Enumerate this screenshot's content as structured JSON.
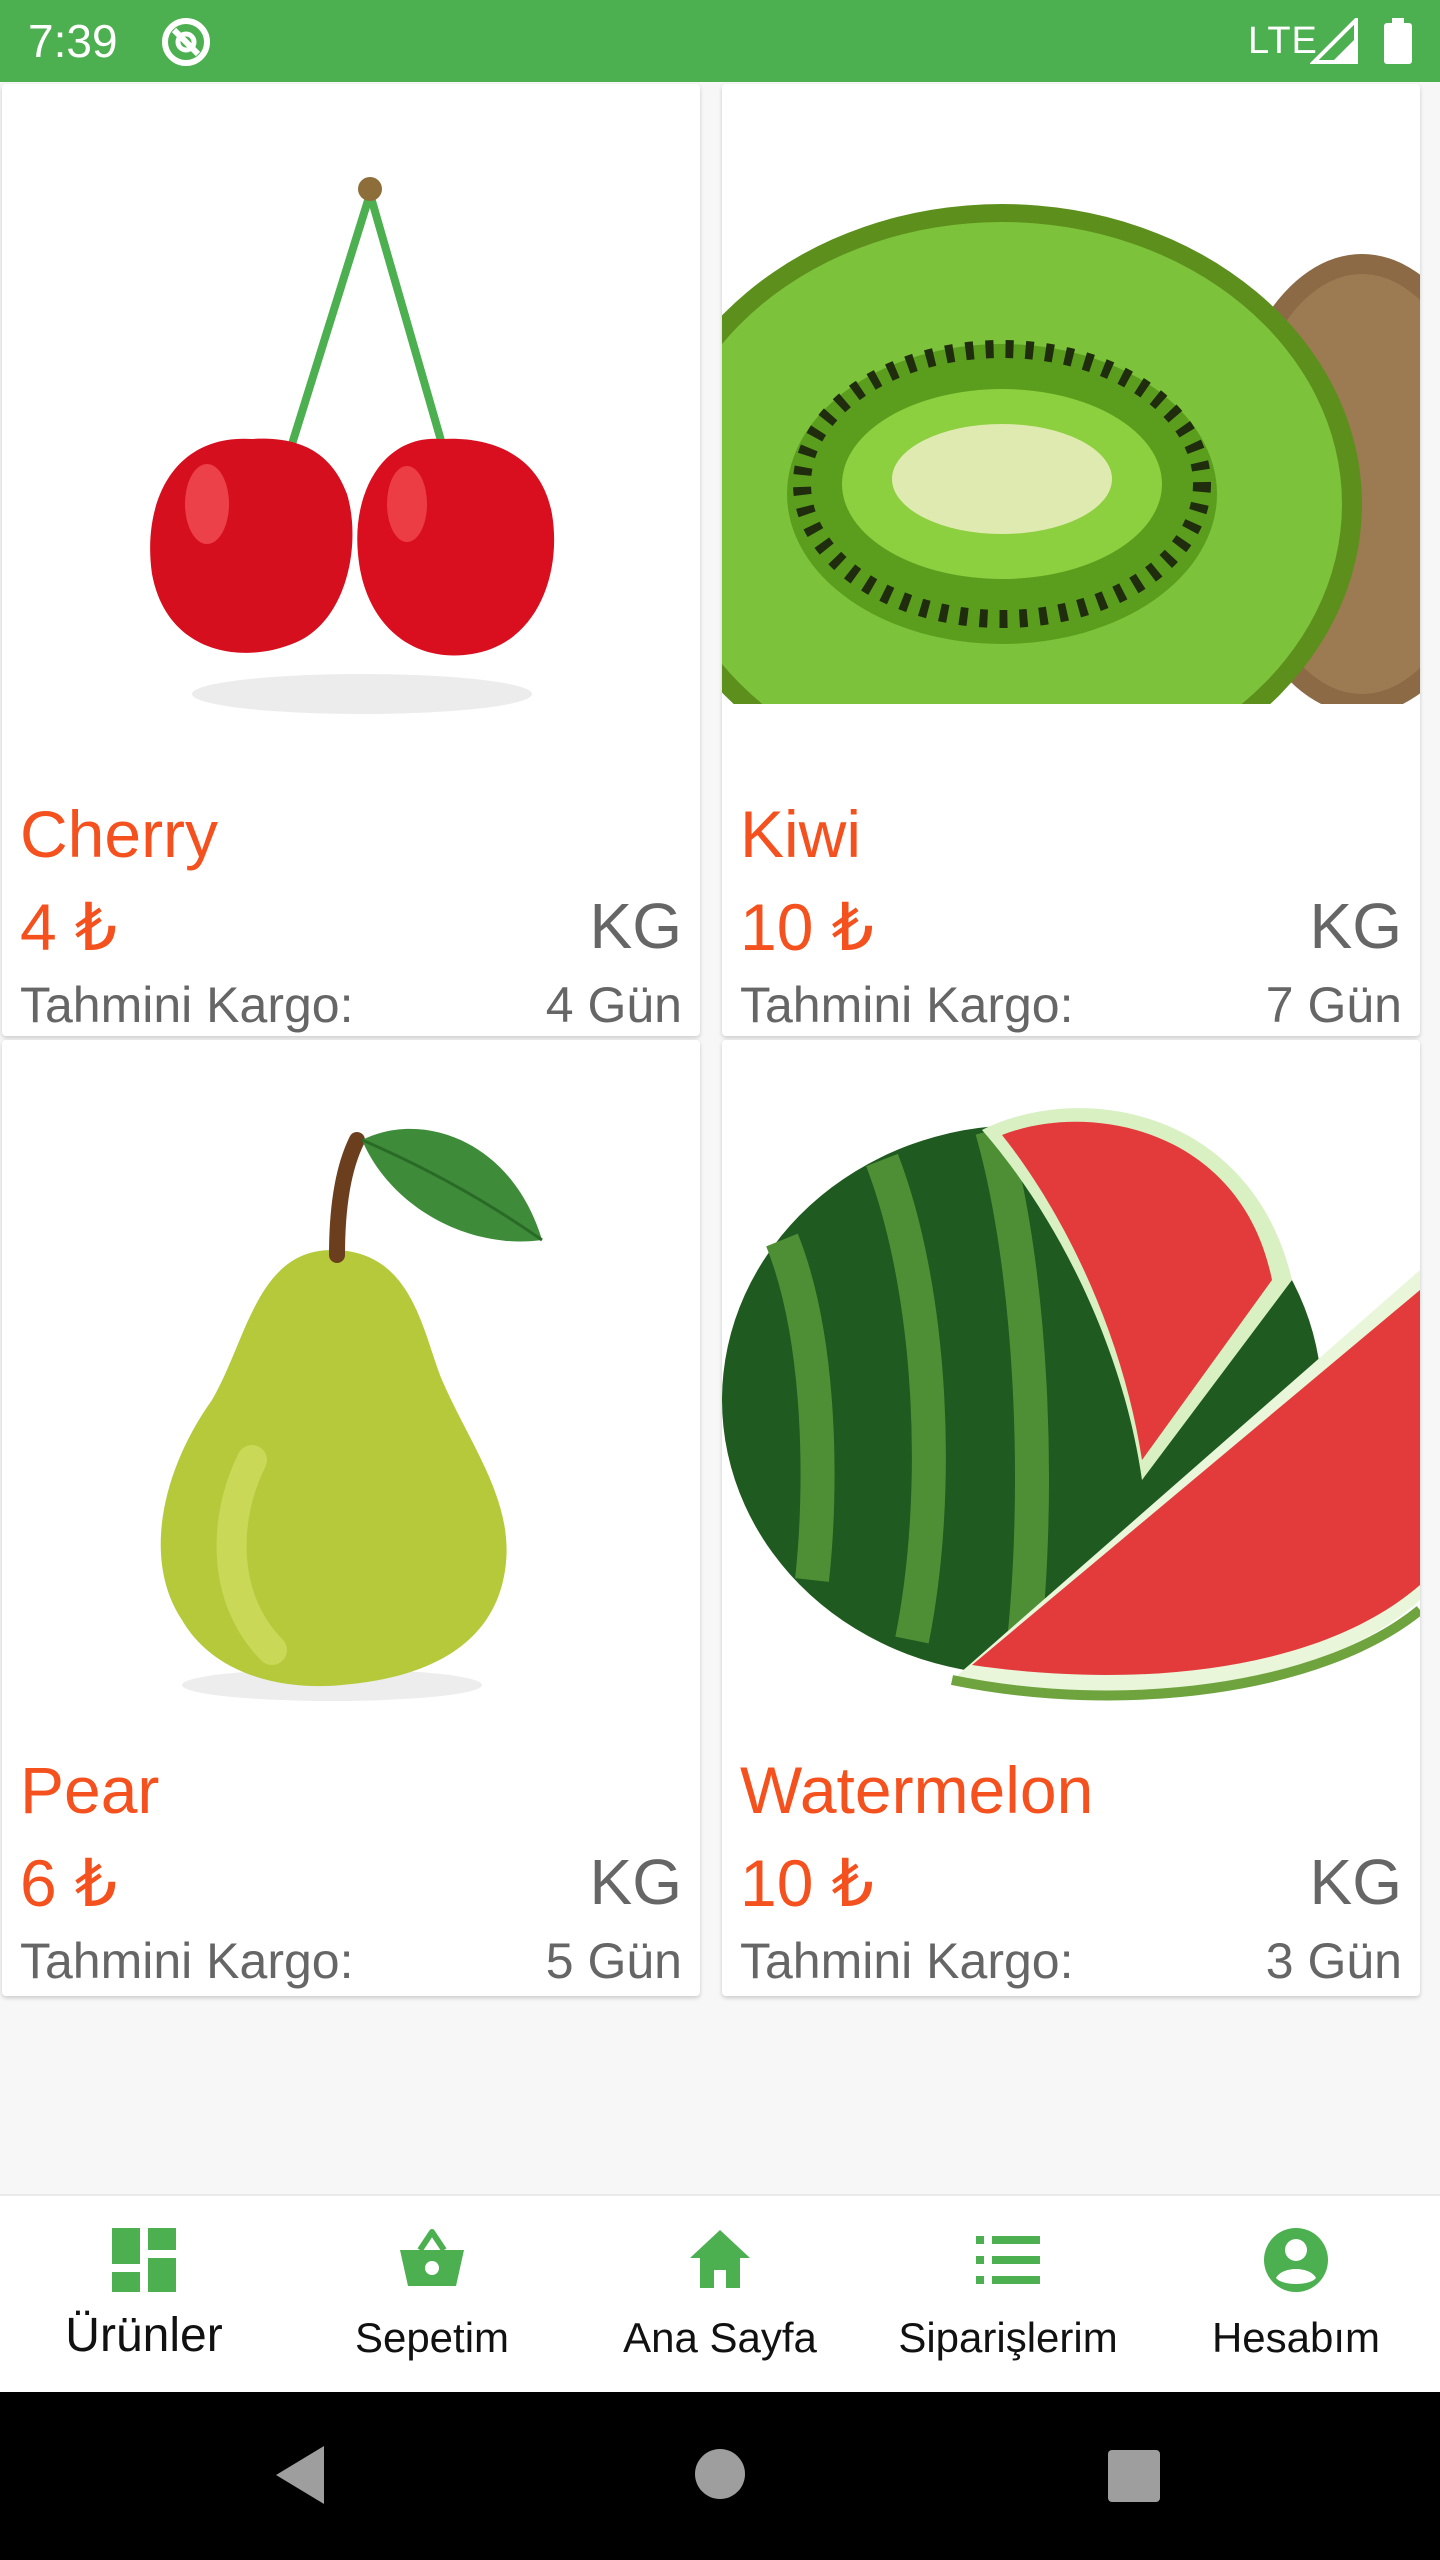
{
  "status_bar": {
    "time": "7:39",
    "network": "LTE",
    "background_color": "#4caf50"
  },
  "products": [
    {
      "name": "Cherry",
      "price": "4 ₺",
      "unit": "KG",
      "cargo_label": "Tahmini Kargo:",
      "cargo_value": "4 Gün",
      "image_icon": "cherry-image"
    },
    {
      "name": "Kiwi",
      "price": "10 ₺",
      "unit": "KG",
      "cargo_label": "Tahmini Kargo:",
      "cargo_value": "7 Gün",
      "image_icon": "kiwi-image"
    },
    {
      "name": "Pear",
      "price": "6 ₺",
      "unit": "KG",
      "cargo_label": "Tahmini Kargo:",
      "cargo_value": "5 Gün",
      "image_icon": "pear-image"
    },
    {
      "name": "Watermelon",
      "price": "10 ₺",
      "unit": "KG",
      "cargo_label": "Tahmini Kargo:",
      "cargo_value": "3 Gün",
      "image_icon": "watermelon-image"
    }
  ],
  "bottom_nav": {
    "items": [
      {
        "label": "Ürünler",
        "icon": "dashboard-icon",
        "active": true
      },
      {
        "label": "Sepetim",
        "icon": "basket-icon",
        "active": false
      },
      {
        "label": "Ana Sayfa",
        "icon": "home-icon",
        "active": false
      },
      {
        "label": "Siparişlerim",
        "icon": "list-icon",
        "active": false
      },
      {
        "label": "Hesabım",
        "icon": "account-icon",
        "active": false
      }
    ],
    "icon_color": "#4caf50"
  },
  "colors": {
    "accent": "#f4511e",
    "secondary_text": "#666666"
  }
}
